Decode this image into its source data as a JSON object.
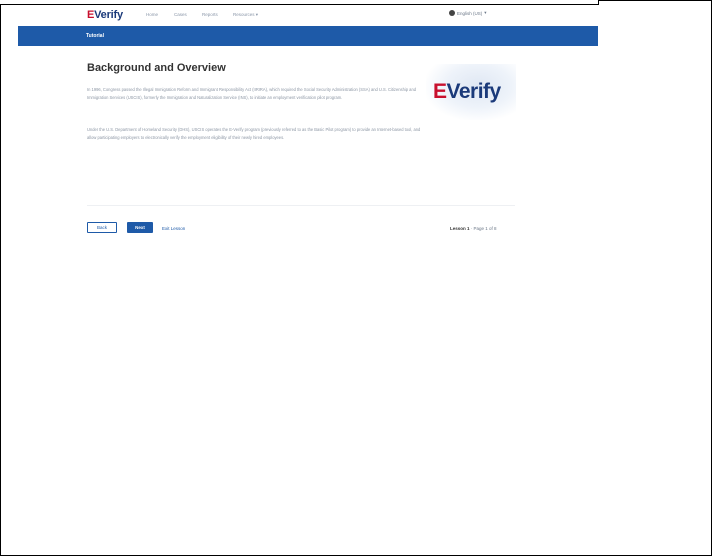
{
  "app": {
    "logo_prefix": "E",
    "logo_suffix": "Verify"
  },
  "nav": {
    "items": [
      "Home",
      "Cases",
      "Reports",
      "Resources"
    ],
    "language": "English (US)"
  },
  "banner": {
    "label": "Tutorial"
  },
  "main": {
    "title": "Background and Overview",
    "paragraphs": [
      "In 1996, Congress passed the Illegal Immigration Reform and Immigrant Responsibility Act (IIRIRA), which required the Social Security Administration (SSA) and U.S. Citizenship and Immigration Services (USCIS), formerly the Immigration and Naturalization Service (INS), to initiate an employment verification pilot program.",
      "Under the U.S. Department of Homeland Security (DHS), USCIS operates the E-Verify program (previously referred to as the Basic Pilot program) to provide an Internet-based tool, and allow participating employers to electronically verify the employment eligibility of their newly hired employees."
    ]
  },
  "footer": {
    "back_label": "Back",
    "next_label": "Next",
    "exit_label": "Exit Lesson",
    "lesson_label": "Lesson 1",
    "page_label": "Page 1 of 8"
  },
  "colors": {
    "brand_blue": "#1e5aa8",
    "brand_red": "#c8102e",
    "logo_navy": "#1b3a7a"
  }
}
